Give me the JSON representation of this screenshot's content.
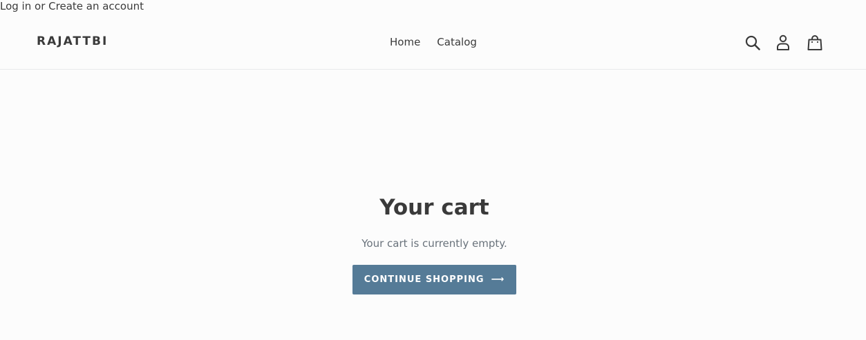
{
  "account_links": {
    "login": "Log in",
    "separator": "or",
    "create": "Create an account"
  },
  "header": {
    "logo": "RAJATTBI",
    "nav": [
      {
        "label": "Home"
      },
      {
        "label": "Catalog"
      }
    ],
    "icons": {
      "search": "search-icon",
      "account": "account-icon",
      "cart": "cart-icon"
    }
  },
  "cart": {
    "title": "Your cart",
    "empty_message": "Your cart is currently empty.",
    "continue_label": "CONTINUE SHOPPING",
    "continue_arrow": "⟶"
  },
  "colors": {
    "text": "#3a3a3a",
    "muted": "#69727b",
    "button_bg": "#557b97",
    "page_bg": "#fcfcfc",
    "border": "#e8e9eb"
  }
}
